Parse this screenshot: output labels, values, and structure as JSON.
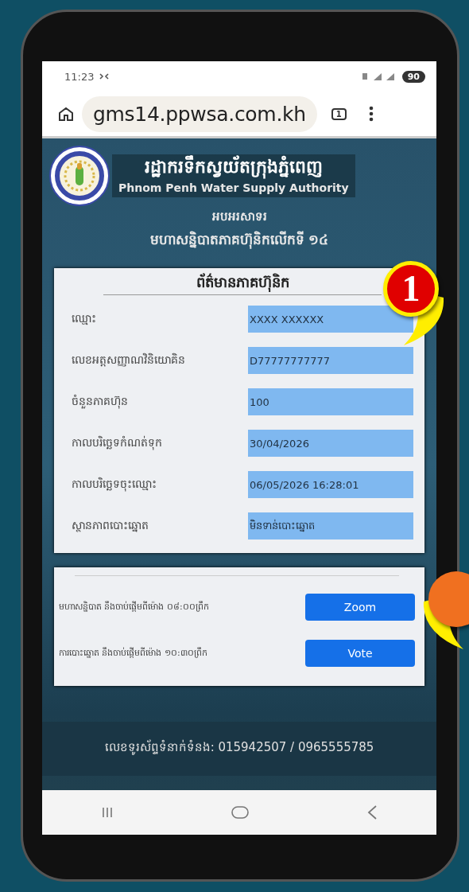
{
  "status_bar": {
    "time": "11:23",
    "battery": "90"
  },
  "browser": {
    "url": "gms14.ppwsa.com.kh",
    "tab_count": "1"
  },
  "header": {
    "title_km": "រដ្ឋាករទឹកស្វយ័តក្រុងភ្នំពេញ",
    "title_en": "Phnom Penh Water Supply Authority",
    "greeting": "អបអរសាទរ",
    "subtitle": "មហាសន្និបាតភាគហ៊ុនិកលើកទី ១៤"
  },
  "info_card": {
    "title": "ព័ត៌មានភាគហ៊ុនិក",
    "fields": [
      {
        "label": "ឈ្មោះ",
        "value": "XXXX XXXXXX"
      },
      {
        "label": "លេខអត្តសញ្ញាណវិនិយោគិន",
        "value": "D77777777777"
      },
      {
        "label": "ចំនួនភាគហ៊ុន",
        "value": "100"
      },
      {
        "label": "កាលបរិច្ឆេទកំណត់ទុក",
        "value": "30/04/2026"
      },
      {
        "label": "កាលបរិច្ឆេទចុះឈ្មោះ",
        "value": "06/05/2026 16:28:01"
      },
      {
        "label": "ស្ថានភាពបោះឆ្នោត",
        "value": "មិនទាន់បោះឆ្នោត"
      }
    ]
  },
  "actions": [
    {
      "text": "មហាសន្និបាត នឹងចាប់ផ្តើមពីម៉ោង ០៨:០០ព្រឹក",
      "button": "Zoom"
    },
    {
      "text": "ការបោះឆ្នោត នឹងចាប់ផ្តើមពីម៉ោង ១០:៣០ព្រឹក",
      "button": "Vote"
    }
  ],
  "footer": {
    "contact": "លេខទូរស័ព្ទទំនាក់ទំនង: 015942507 / 0965555785"
  },
  "callouts": [
    {
      "number": "1",
      "color": "#e00000"
    },
    {
      "color": "#f07020"
    }
  ]
}
